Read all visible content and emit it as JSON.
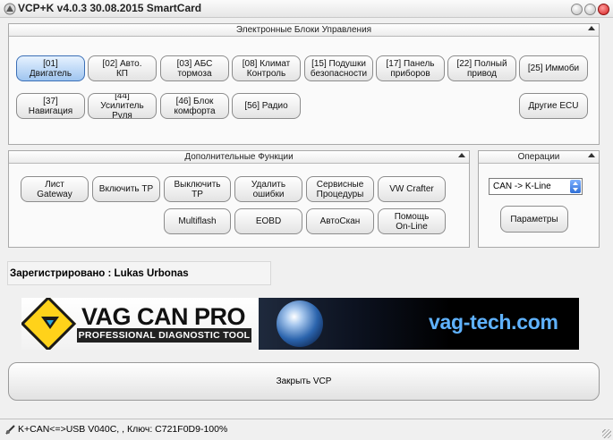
{
  "window": {
    "title": "VCP+K v4.0.3 30.08.2015 SmartCard"
  },
  "ecu_panel": {
    "title": "Электронные Блоки Управления",
    "buttons": [
      {
        "label": "[01]\nДвигатель",
        "active": true
      },
      {
        "label": "[02] Авто.\nКП"
      },
      {
        "label": "[03] АБС\nтормоза"
      },
      {
        "label": "[08] Климат\nКонтроль"
      },
      {
        "label": "[15] Подушки\nбезопасности"
      },
      {
        "label": "[17] Панель\nприборов"
      },
      {
        "label": "[22] Полный\nпривод"
      },
      {
        "label": "[25] Иммоби"
      },
      {
        "label": "[37]\nНавигация"
      },
      {
        "label": "[44]\nУсилитель\nРуля"
      },
      {
        "label": "[46] Блок\nкомфорта"
      },
      {
        "label": "[56] Радио"
      },
      {
        "label": "Другие ECU"
      }
    ]
  },
  "functions_panel": {
    "title": "Дополнительные Функции",
    "buttons": [
      {
        "label": "Лист\nGateway"
      },
      {
        "label": "Включить ТР"
      },
      {
        "label": "Выключить\nТР"
      },
      {
        "label": "Удалить\nошибки"
      },
      {
        "label": "Сервисные\nПроцедуры"
      },
      {
        "label": "VW Crafter"
      },
      {
        "label": "Multiflash"
      },
      {
        "label": "EOBD"
      },
      {
        "label": "АвтоСкан"
      },
      {
        "label": "Помощь\nOn-Line"
      }
    ]
  },
  "operations_panel": {
    "title": "Операции",
    "select_value": "CAN -> K-Line",
    "params_label": "Параметры"
  },
  "registration": {
    "text": "Зарегистрировано : Lukas Urbonas"
  },
  "banner": {
    "brand": "VAG CAN PRO",
    "subtitle": "PROFESSIONAL DIAGNOSTIC TOOL",
    "site": "vag-tech.com"
  },
  "close_label": "Закрыть VCP",
  "status": {
    "text": "K+CAN<=>USB V040C, , Ключ: C721F0D9-100%"
  }
}
